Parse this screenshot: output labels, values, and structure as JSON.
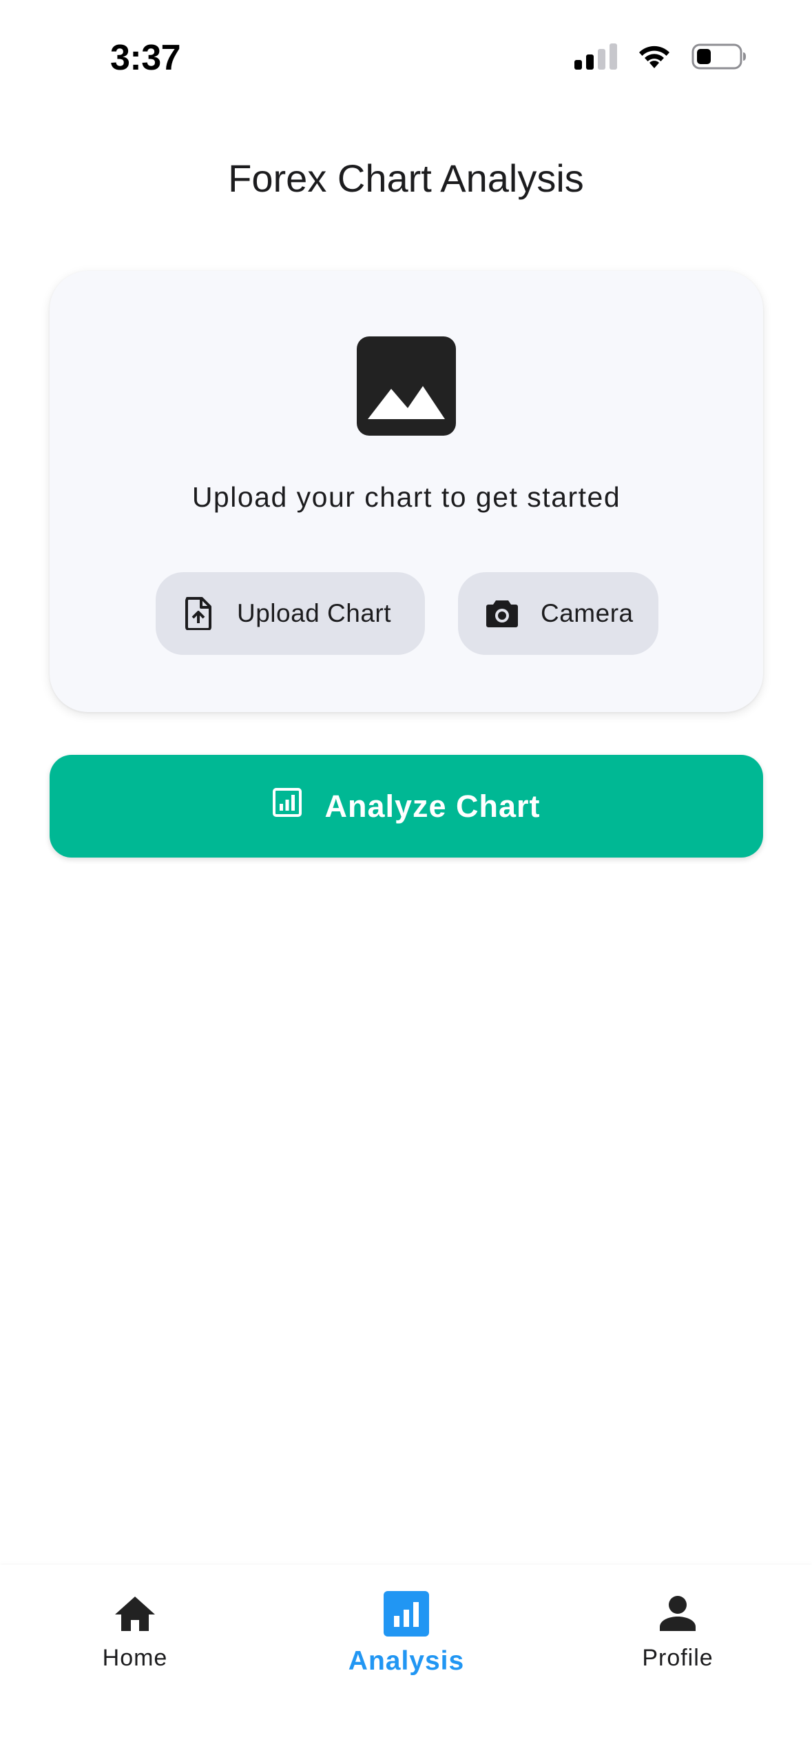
{
  "status_bar": {
    "time": "3:37"
  },
  "header": {
    "title": "Forex Chart Analysis"
  },
  "upload_card": {
    "prompt": "Upload your chart to get started",
    "upload_button_label": "Upload Chart",
    "camera_button_label": "Camera",
    "placeholder_icon": "image-icon"
  },
  "analyze_button": {
    "label": "Analyze Chart",
    "icon": "analytics-icon",
    "color": "#00b894"
  },
  "bottom_nav": {
    "active": "Analysis",
    "active_color": "#2196f3",
    "items": [
      {
        "label": "Home",
        "icon": "home-icon"
      },
      {
        "label": "Analysis",
        "icon": "analytics-icon"
      },
      {
        "label": "Profile",
        "icon": "person-icon"
      }
    ]
  }
}
